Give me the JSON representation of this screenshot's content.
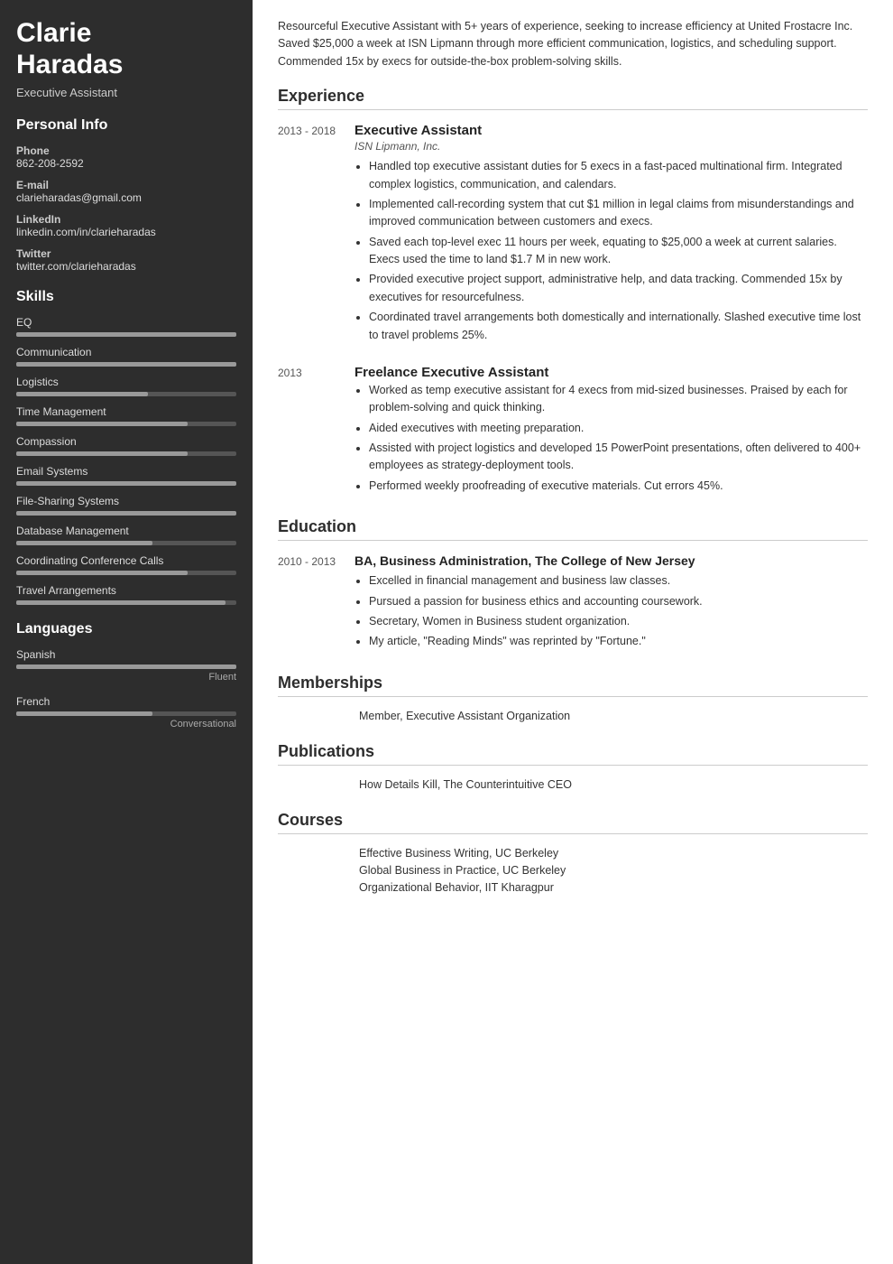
{
  "sidebar": {
    "name_line1": "Clarie",
    "name_line2": "Haradas",
    "title": "Executive Assistant",
    "personal_info": {
      "section_title": "Personal Info",
      "phone_label": "Phone",
      "phone": "862-208-2592",
      "email_label": "E-mail",
      "email": "clarieharadas@gmail.com",
      "linkedin_label": "LinkedIn",
      "linkedin": "linkedin.com/in/clarieharadas",
      "twitter_label": "Twitter",
      "twitter": "twitter.com/clarieharadas"
    },
    "skills": {
      "section_title": "Skills",
      "items": [
        {
          "name": "EQ",
          "pct": 100
        },
        {
          "name": "Communication",
          "pct": 100
        },
        {
          "name": "Logistics",
          "pct": 60
        },
        {
          "name": "Time Management",
          "pct": 78
        },
        {
          "name": "Compassion",
          "pct": 78
        },
        {
          "name": "Email Systems",
          "pct": 100
        },
        {
          "name": "File-Sharing Systems",
          "pct": 100
        },
        {
          "name": "Database Management",
          "pct": 62
        },
        {
          "name": "Coordinating Conference Calls",
          "pct": 78
        },
        {
          "name": "Travel Arrangements",
          "pct": 95
        }
      ]
    },
    "languages": {
      "section_title": "Languages",
      "items": [
        {
          "name": "Spanish",
          "pct": 100,
          "level": "Fluent"
        },
        {
          "name": "French",
          "pct": 62,
          "level": "Conversational"
        }
      ]
    }
  },
  "main": {
    "summary": "Resourceful Executive Assistant with 5+ years of experience, seeking to increase efficiency at United Frostacre Inc. Saved $25,000 a week at ISN Lipmann through more efficient communication, logistics, and scheduling support. Commended 15x by execs for outside-the-box problem-solving skills.",
    "experience": {
      "section_title": "Experience",
      "items": [
        {
          "date": "2013 - 2018",
          "role": "Executive Assistant",
          "company": "ISN Lipmann, Inc.",
          "bullets": [
            "Handled top executive assistant duties for 5 execs in a fast-paced multinational firm. Integrated complex logistics, communication, and calendars.",
            "Implemented call-recording system that cut $1 million in legal claims from misunderstandings and improved communication between customers and execs.",
            "Saved each top-level exec 11 hours per week, equating to $25,000 a week at current salaries. Execs used the time to land $1.7 M in new work.",
            "Provided executive project support, administrative help, and data tracking. Commended 15x by executives for resourcefulness.",
            "Coordinated travel arrangements both domestically and internationally. Slashed executive time lost to travel problems 25%."
          ]
        },
        {
          "date": "2013",
          "role": "Freelance Executive Assistant",
          "company": "",
          "bullets": [
            "Worked as temp executive assistant for 4 execs from mid-sized businesses. Praised by each for problem-solving and quick thinking.",
            "Aided executives with meeting preparation.",
            "Assisted with project logistics and developed 15 PowerPoint presentations, often delivered to 400+ employees as strategy-deployment tools.",
            "Performed weekly proofreading of executive materials. Cut errors 45%."
          ]
        }
      ]
    },
    "education": {
      "section_title": "Education",
      "items": [
        {
          "date": "2010 - 2013",
          "degree": "BA, Business Administration, The College of New Jersey",
          "bullets": [
            "Excelled in financial management and business law classes.",
            "Pursued a passion for business ethics and accounting coursework.",
            "Secretary, Women in Business student organization.",
            "My article, \"Reading Minds\" was reprinted by \"Fortune.\""
          ]
        }
      ]
    },
    "memberships": {
      "section_title": "Memberships",
      "items": [
        "Member, Executive Assistant Organization"
      ]
    },
    "publications": {
      "section_title": "Publications",
      "items": [
        "How Details Kill, The Counterintuitive CEO"
      ]
    },
    "courses": {
      "section_title": "Courses",
      "items": [
        "Effective Business Writing, UC Berkeley",
        "Global Business in Practice, UC Berkeley",
        "Organizational Behavior, IIT Kharagpur"
      ]
    }
  }
}
